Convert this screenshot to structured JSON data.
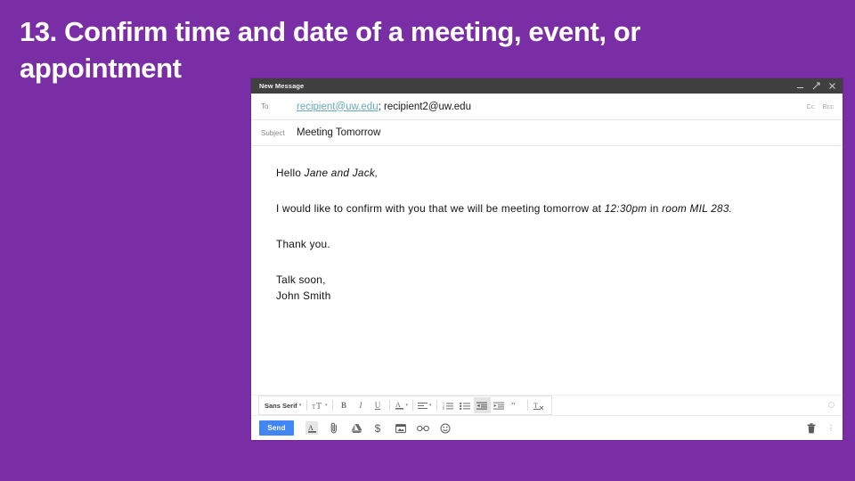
{
  "slide": {
    "title": "13. Confirm time and date of a meeting, event, or appointment",
    "background_color": "#7a2ea6",
    "title_color": "#ffffff"
  },
  "compose": {
    "window_title": "New Message",
    "window_controls": {
      "minimize": "minimize-icon",
      "expand": "expand-icon",
      "close": "close-icon"
    },
    "to": {
      "label": "To",
      "link_value": "recipient@uw.edu",
      "rest_value": "; recipient2@uw.edu",
      "link_color": "#66a9bb",
      "cc_label": "Cc",
      "bcc_label": "Bcc"
    },
    "subject": {
      "label": "Subject",
      "value": "Meeting Tomorrow"
    },
    "body": {
      "greeting_plain": "Hello ",
      "greeting_italic": "Jane and Jack,",
      "para2_part1": "I would like to confirm with you that we will be meeting tomorrow at ",
      "para2_italic1": "12:30pm",
      "para2_part2": " in ",
      "para2_italic2": "room MIL 283.",
      "thanks": "Thank you.",
      "signoff": "Talk soon,",
      "signature": "John Smith"
    },
    "toolbar": {
      "font_name": "Sans Serif",
      "size_label": "size-icon",
      "bold_label": "B",
      "italic_label": "I",
      "underline_label": "U",
      "text_color_label": "A",
      "items": [
        "font-name",
        "font-size",
        "bold",
        "italic",
        "underline",
        "text-color",
        "align",
        "numbered-list",
        "bulleted-list",
        "indent-more",
        "indent-less",
        "quote",
        "remove-formatting"
      ]
    },
    "send_bar": {
      "send_label": "Send",
      "icons": [
        "formatting-icon",
        "attach-file-icon",
        "insert-drive-icon",
        "insert-money-icon",
        "insert-photo-icon",
        "insert-link-icon",
        "insert-emoji-icon"
      ],
      "discard_icon": "trash-icon",
      "more_options_icon": "more-options-icon",
      "send_color": "#4285f4"
    }
  }
}
